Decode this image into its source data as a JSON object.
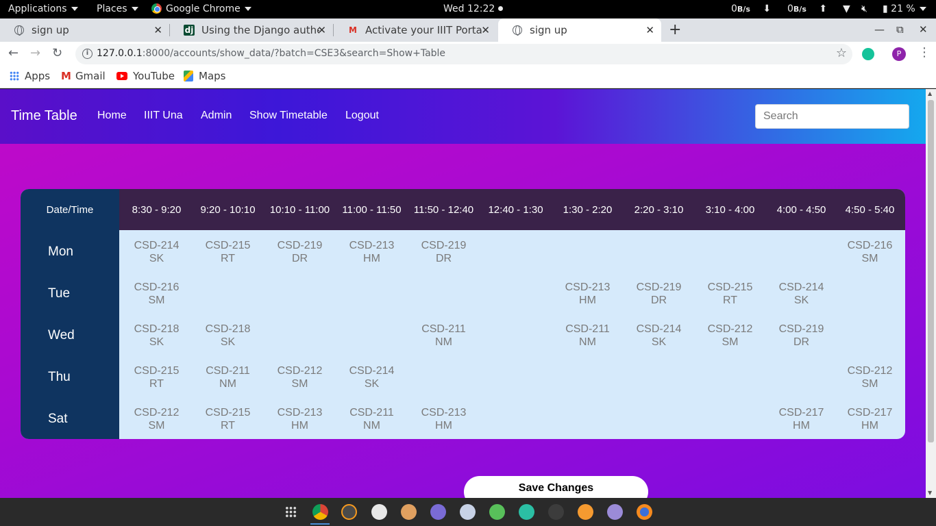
{
  "topbar": {
    "applications": "Applications",
    "places": "Places",
    "app_name": "Google Chrome",
    "clock": "Wed 12:22",
    "net_down": "0",
    "net_down_unit": "B/s",
    "net_up": "0",
    "net_up_unit": "B/s",
    "battery": "21 %"
  },
  "tabs": [
    {
      "title": "sign up",
      "favicon": "globe-icon"
    },
    {
      "title": "Using the Django authentication system",
      "favicon": "django-icon"
    },
    {
      "title": "Activate your IIIT Portal account",
      "favicon": "gmail-icon"
    },
    {
      "title": "sign up",
      "favicon": "globe-icon",
      "active": true
    }
  ],
  "address": {
    "host": "127.0.0.1",
    "rest": ":8000/accounts/show_data/?batch=CSE3&search=Show+Table"
  },
  "bookmarks": [
    "Apps",
    "Gmail",
    "YouTube",
    "Maps"
  ],
  "profile_initial": "P",
  "site": {
    "brand": "Time Table",
    "nav": [
      "Home",
      "IIIT Una",
      "Admin",
      "Show Timetable",
      "Logout"
    ],
    "search_placeholder": "Search"
  },
  "timetable": {
    "corner": "Date/Time",
    "times": [
      "8:30 - 9:20",
      "9:20 - 10:10",
      "10:10 - 11:00",
      "11:00 - 11:50",
      "11:50 - 12:40",
      "12:40 - 1:30",
      "1:30 - 2:20",
      "2:20 - 3:10",
      "3:10 - 4:00",
      "4:00 - 4:50",
      "4:50 - 5:40"
    ],
    "rows": [
      {
        "day": "Mon",
        "cells": [
          [
            "CSD-214",
            "SK"
          ],
          [
            "CSD-215",
            "RT"
          ],
          [
            "CSD-219",
            "DR"
          ],
          [
            "CSD-213",
            "HM"
          ],
          [
            "CSD-219",
            "DR"
          ],
          null,
          null,
          null,
          null,
          null,
          [
            "CSD-216",
            "SM"
          ]
        ]
      },
      {
        "day": "Tue",
        "cells": [
          [
            "CSD-216",
            "SM"
          ],
          null,
          null,
          null,
          null,
          null,
          [
            "CSD-213",
            "HM"
          ],
          [
            "CSD-219",
            "DR"
          ],
          [
            "CSD-215",
            "RT"
          ],
          [
            "CSD-214",
            "SK"
          ],
          null
        ]
      },
      {
        "day": "Wed",
        "cells": [
          [
            "CSD-218",
            "SK"
          ],
          [
            "CSD-218",
            "SK"
          ],
          null,
          null,
          [
            "CSD-211",
            "NM"
          ],
          null,
          [
            "CSD-211",
            "NM"
          ],
          [
            "CSD-214",
            "SK"
          ],
          [
            "CSD-212",
            "SM"
          ],
          [
            "CSD-219",
            "DR"
          ],
          null
        ]
      },
      {
        "day": "Thu",
        "cells": [
          [
            "CSD-215",
            "RT"
          ],
          [
            "CSD-211",
            "NM"
          ],
          [
            "CSD-212",
            "SM"
          ],
          [
            "CSD-214",
            "SK"
          ],
          null,
          null,
          null,
          null,
          null,
          null,
          [
            "CSD-212",
            "SM"
          ]
        ]
      },
      {
        "day": "Sat",
        "cells": [
          [
            "CSD-212",
            "SM"
          ],
          [
            "CSD-215",
            "RT"
          ],
          [
            "CSD-213",
            "HM"
          ],
          [
            "CSD-211",
            "NM"
          ],
          [
            "CSD-213",
            "HM"
          ],
          null,
          null,
          null,
          null,
          [
            "CSD-217",
            "HM"
          ],
          [
            "CSD-217",
            "HM"
          ]
        ]
      }
    ]
  },
  "save_button": "Save Changes",
  "colors": {
    "page_bg": "#b70bcc",
    "navbar_start": "#5a0fc9",
    "navbar_end": "#14a8ee",
    "table_header": "#3a2249",
    "day_column": "#0f3460",
    "cell_bg": "#d6eafb"
  }
}
